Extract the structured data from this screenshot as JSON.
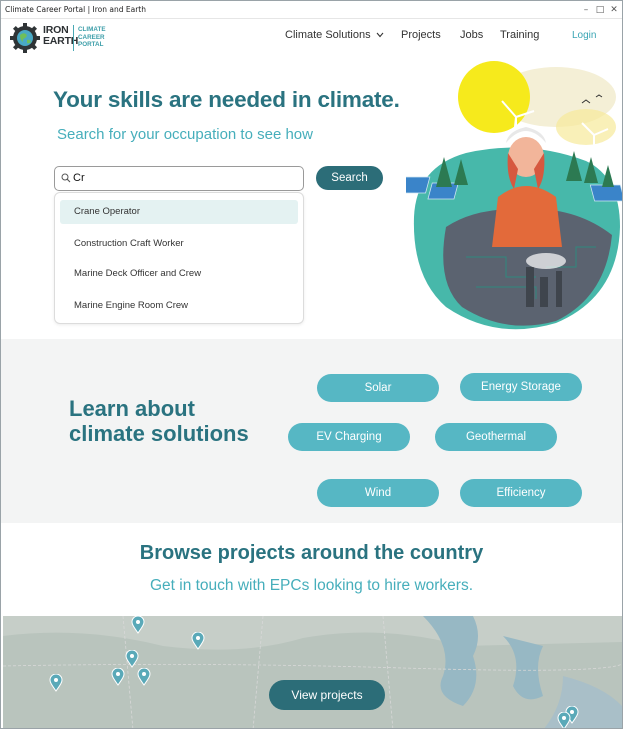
{
  "window": {
    "title": "Climate Career Portal | Iron and Earth",
    "controls": [
      "minimize-icon",
      "maximize-icon",
      "close-icon"
    ]
  },
  "nav": {
    "logo_main_line1": "IRON",
    "logo_main_line2": "EARTH",
    "logo_sub_line1": "CLIMATE",
    "logo_sub_line2": "CAREER",
    "logo_sub_line3": "PORTAL",
    "items": [
      "Climate Solutions",
      "Projects",
      "Jobs",
      "Training"
    ],
    "login": "Login"
  },
  "hero": {
    "title": "Your skills are needed in climate.",
    "subtitle": "Search for your occupation to see how",
    "search_value": "Cr",
    "search_button": "Search",
    "suggestions": [
      "Crane Operator",
      "Construction Craft Worker",
      "Marine Deck Officer and Crew",
      "Marine Engine Room Crew"
    ]
  },
  "solutions": {
    "title_line1": "Learn about",
    "title_line2": "climate solutions",
    "pills": [
      "Solar",
      "Energy Storage",
      "EV Charging",
      "Geothermal",
      "Wind",
      "Efficiency"
    ]
  },
  "projects": {
    "title": "Browse projects around the country",
    "subtitle": "Get in touch with EPCs looking to hire workers.",
    "button": "View projects"
  },
  "colors": {
    "brand_dark": "#2a7380",
    "brand_teal": "#46aebb",
    "pill_teal": "#56b7c4",
    "button_dark": "#2c6d78",
    "section_gray": "#f3f4f4"
  }
}
